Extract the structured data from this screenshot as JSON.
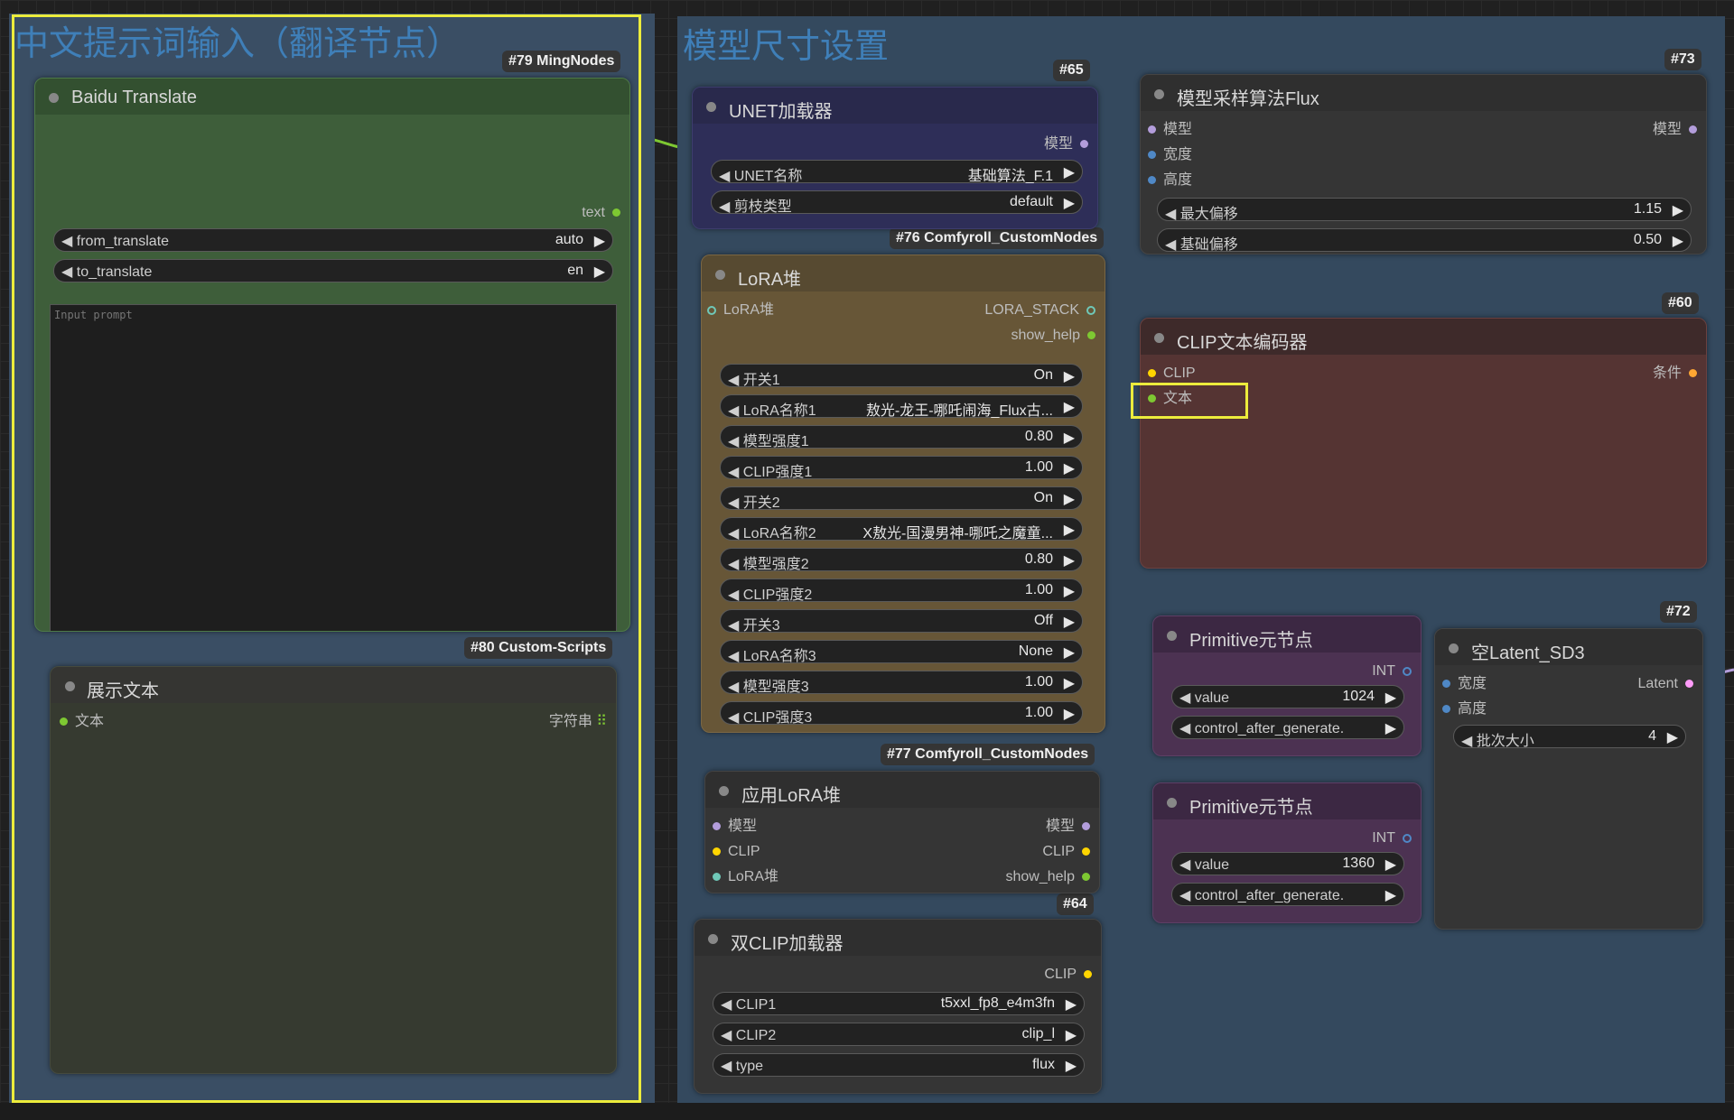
{
  "groups": {
    "left_title": "中文提示词输入（翻译节点）",
    "right_title": "模型尺寸设置"
  },
  "badges": {
    "b79": "#79 MingNodes",
    "b80": "#80 Custom-Scripts",
    "b65": "#65",
    "b73": "#73",
    "b76": "#76 Comfyroll_CustomNodes",
    "b60": "#60",
    "b72": "#72",
    "b77": "#77 Comfyroll_CustomNodes",
    "b64": "#64"
  },
  "baidu": {
    "title": "Baidu Translate",
    "out_text": "text",
    "from_label": "from_translate",
    "from_value": "auto",
    "to_label": "to_translate",
    "to_value": "en",
    "placeholder": "Input prompt"
  },
  "show_text": {
    "title": "展示文本",
    "in_text": "文本",
    "out_string": "字符串"
  },
  "unet": {
    "title": "UNET加载器",
    "out_model": "模型",
    "name_label": "UNET名称",
    "name_value": "基础算法_F.1",
    "prune_label": "剪枝类型",
    "prune_value": "default"
  },
  "sampling": {
    "title": "模型采样算法Flux",
    "in_model": "模型",
    "in_width": "宽度",
    "in_height": "高度",
    "out_model": "模型",
    "max_shift_label": "最大偏移",
    "max_shift_value": "1.15",
    "base_shift_label": "基础偏移",
    "base_shift_value": "0.50"
  },
  "lora_stack": {
    "title": "LoRA堆",
    "in_stack": "LoRA堆",
    "out_stack": "LORA_STACK",
    "out_help": "show_help",
    "rows": [
      {
        "label": "开关1",
        "value": "On"
      },
      {
        "label": "LoRA名称1",
        "value": "敖光-龙王-哪吒闹海_Flux古..."
      },
      {
        "label": "模型强度1",
        "value": "0.80"
      },
      {
        "label": "CLIP强度1",
        "value": "1.00"
      },
      {
        "label": "开关2",
        "value": "On"
      },
      {
        "label": "LoRA名称2",
        "value": "X敖光-国漫男神-哪吒之魔童..."
      },
      {
        "label": "模型强度2",
        "value": "0.80"
      },
      {
        "label": "CLIP强度2",
        "value": "1.00"
      },
      {
        "label": "开关3",
        "value": "Off"
      },
      {
        "label": "LoRA名称3",
        "value": "None"
      },
      {
        "label": "模型强度3",
        "value": "1.00"
      },
      {
        "label": "CLIP强度3",
        "value": "1.00"
      }
    ]
  },
  "clip_encoder": {
    "title": "CLIP文本编码器",
    "in_clip": "CLIP",
    "in_text": "文本",
    "out_cond": "条件"
  },
  "primitive1": {
    "title": "Primitive元节点",
    "out_int": "INT",
    "value_label": "value",
    "value": "1024",
    "cag_label": "control_after_generate."
  },
  "primitive2": {
    "title": "Primitive元节点",
    "out_int": "INT",
    "value_label": "value",
    "value": "1360",
    "cag_label": "control_after_generate."
  },
  "latent": {
    "title": "空Latent_SD3",
    "in_width": "宽度",
    "in_height": "高度",
    "out_latent": "Latent",
    "batch_label": "批次大小",
    "batch_value": "4"
  },
  "apply_lora": {
    "title": "应用LoRA堆",
    "in_model": "模型",
    "in_clip": "CLIP",
    "in_stack": "LoRA堆",
    "out_model": "模型",
    "out_clip": "CLIP",
    "out_help": "show_help"
  },
  "dual_clip": {
    "title": "双CLIP加载器",
    "out_clip": "CLIP",
    "clip1_label": "CLIP1",
    "clip1_value": "t5xxl_fp8_e4m3fn",
    "clip2_label": "CLIP2",
    "clip2_value": "clip_l",
    "type_label": "type",
    "type_value": "flux"
  },
  "colors": {
    "model_port": "#b39ddb",
    "clip_port": "#ffd500",
    "int_port": "#4f88c6",
    "text_port": "#7ec832",
    "lora_port": "#6fc8b8",
    "group_highlight": "#ecec3c"
  },
  "icons": {
    "arrow_left": "◀",
    "arrow_right": "▶",
    "grid": "⠿"
  }
}
